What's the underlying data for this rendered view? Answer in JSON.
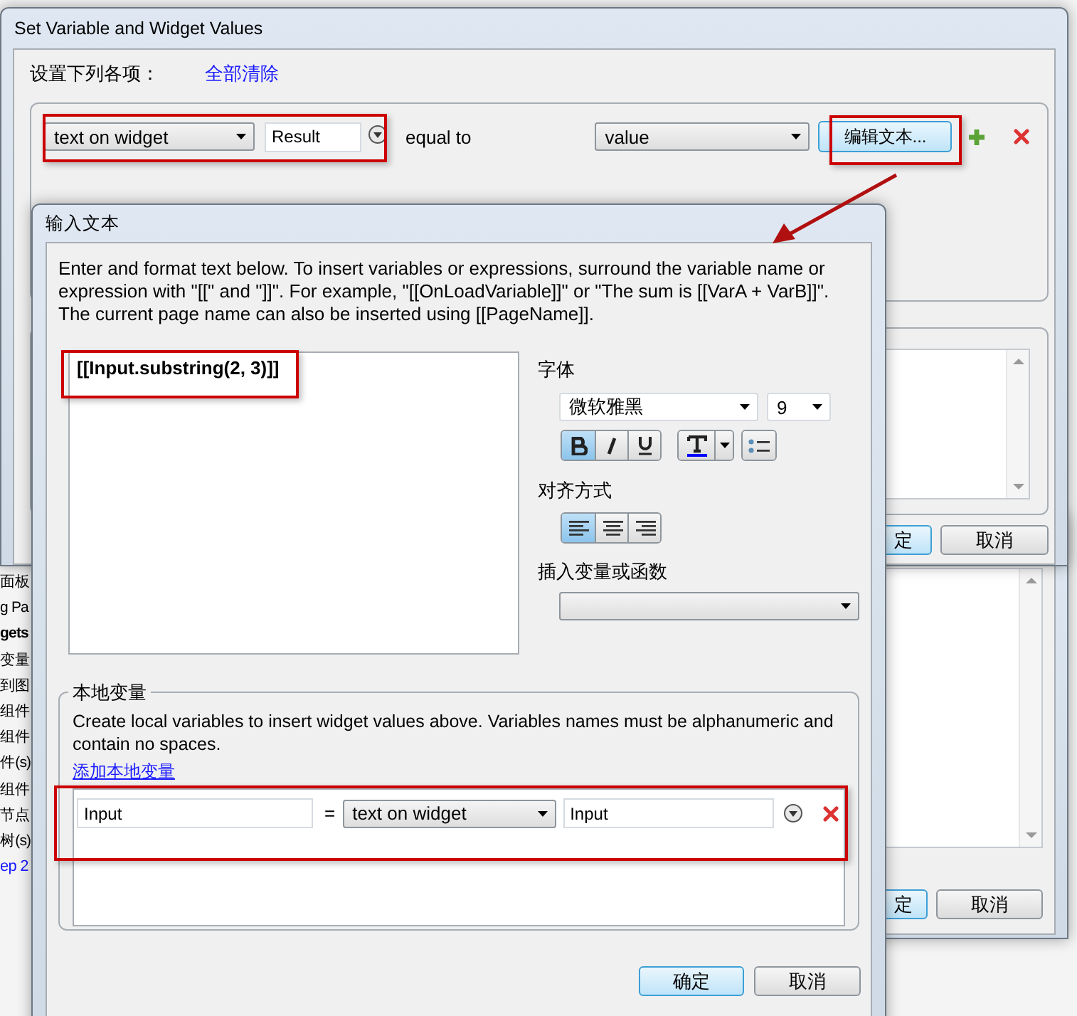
{
  "background_app": {
    "side_labels": [
      {
        "text": "面板",
        "kind": "plain"
      },
      {
        "text": "g Pa",
        "kind": "plain"
      },
      {
        "text": "gets",
        "kind": "bold"
      },
      {
        "text": "变量",
        "kind": "plain"
      },
      {
        "text": "到图",
        "kind": "plain"
      },
      {
        "text": "组件",
        "kind": "plain"
      },
      {
        "text": "组件",
        "kind": "plain"
      },
      {
        "text": "件(s)",
        "kind": "plain"
      },
      {
        "text": "组件",
        "kind": "plain"
      },
      {
        "text": "节点",
        "kind": "plain"
      },
      {
        "text": "树(s)",
        "kind": "plain"
      },
      {
        "text": "ep 2",
        "kind": "link"
      }
    ]
  },
  "back_dialog": {
    "buttons": [
      {
        "label": "定",
        "default": true
      },
      {
        "label": "取消",
        "default": false
      }
    ]
  },
  "variable_dialog": {
    "title": "Set Variable and Widget Values",
    "prompt": "设置下列各项：",
    "clear_all_link": "全部清除",
    "assignment": {
      "target_type": "text on widget",
      "widget": "Result",
      "operator": "equal to",
      "value_type": "value",
      "edit_button": "编辑文本..."
    },
    "buttons": [
      {
        "label": "定",
        "default": true
      },
      {
        "label": "取消",
        "default": false
      }
    ]
  },
  "text_dialog": {
    "title": "输入文本",
    "instructions": "Enter and format text below. To insert variables or expressions, surround the variable name or expression with \"[[\" and \"]]\". For example, \"[[OnLoadVariable]]\" or \"The sum is [[VarA + VarB]]\". The current page name can also be inserted using [[PageName]].",
    "text_value": "[[Input.substring(2, 3)]]",
    "font_label": "字体",
    "font_name": "微软雅黑",
    "font_size": "9",
    "format_buttons": [
      {
        "kind": "bold",
        "selected": true
      },
      {
        "kind": "italic",
        "selected": false
      },
      {
        "kind": "underline",
        "selected": false
      }
    ],
    "align_label": "对齐方式",
    "align_buttons": [
      {
        "kind": "left",
        "selected": true
      },
      {
        "kind": "center",
        "selected": false
      },
      {
        "kind": "right",
        "selected": false
      }
    ],
    "insert_label": "插入变量或函数",
    "local_vars": {
      "legend": "本地变量",
      "description": "Create local variables to insert widget values above. Variables names must be alphanumeric and contain no spaces.",
      "add_link": "添加本地变量",
      "rows": [
        {
          "name": "Input",
          "operator": "=",
          "source": "text on widget",
          "widget": "Input"
        }
      ]
    },
    "buttons": [
      {
        "label": "确定",
        "default": true
      },
      {
        "label": "取消",
        "default": false
      }
    ]
  }
}
